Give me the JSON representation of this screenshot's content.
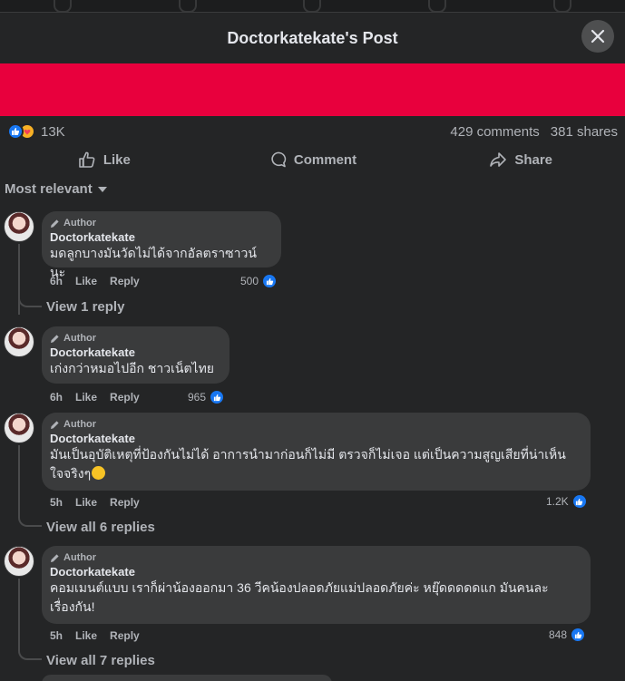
{
  "header": {
    "title": "Doctorkatekate's Post"
  },
  "stats": {
    "reaction_count": "13K",
    "comments": "429 comments",
    "shares": "381 shares"
  },
  "actions": {
    "like": "Like",
    "comment": "Comment",
    "share": "Share"
  },
  "sort": {
    "label": "Most relevant"
  },
  "colors": {
    "banner": "#e8003d",
    "accent": "#1877f2",
    "background": "#242526",
    "bubble": "#3a3b3c"
  },
  "comments": [
    {
      "author_tag": "Author",
      "name": "Doctorkatekate",
      "text": "มดลูกบางมันวัดไม่ได้จากอัลตราซาวน์นะ",
      "time": "6h",
      "like": "Like",
      "reply": "Reply",
      "likes": "500",
      "replies": "View 1 reply"
    },
    {
      "author_tag": "Author",
      "name": "Doctorkatekate",
      "text": "เก่งกว่าหมอไปอีก ชาวเน็ตไทย",
      "time": "6h",
      "like": "Like",
      "reply": "Reply",
      "likes": "965"
    },
    {
      "author_tag": "Author",
      "name": "Doctorkatekate",
      "text_line1": "มันเป็นอุบัติเหตุที่ป้องกันไม่ได้ อาการนำมาก่อนก็ไม่มี ตรวจก็ไม่เจอ แต่เป็นความสูญเสียที่น่าเห็น",
      "text_line2": "ใจจริงๆ",
      "time": "5h",
      "like": "Like",
      "reply": "Reply",
      "likes": "1.2K",
      "replies": "View all 6 replies"
    },
    {
      "author_tag": "Author",
      "name": "Doctorkatekate",
      "text_line1": "คอมเมนต์แบบ เราก็ผ่าน้องออกมา 36 วีคน้องปลอดภัยแม่ปลอดภัยค่ะ หยุ๊ดดดดดแก มันคนละ",
      "text_line2": "เรื่องกัน!",
      "time": "5h",
      "like": "Like",
      "reply": "Reply",
      "likes": "848",
      "replies": "View all 7 replies"
    }
  ]
}
